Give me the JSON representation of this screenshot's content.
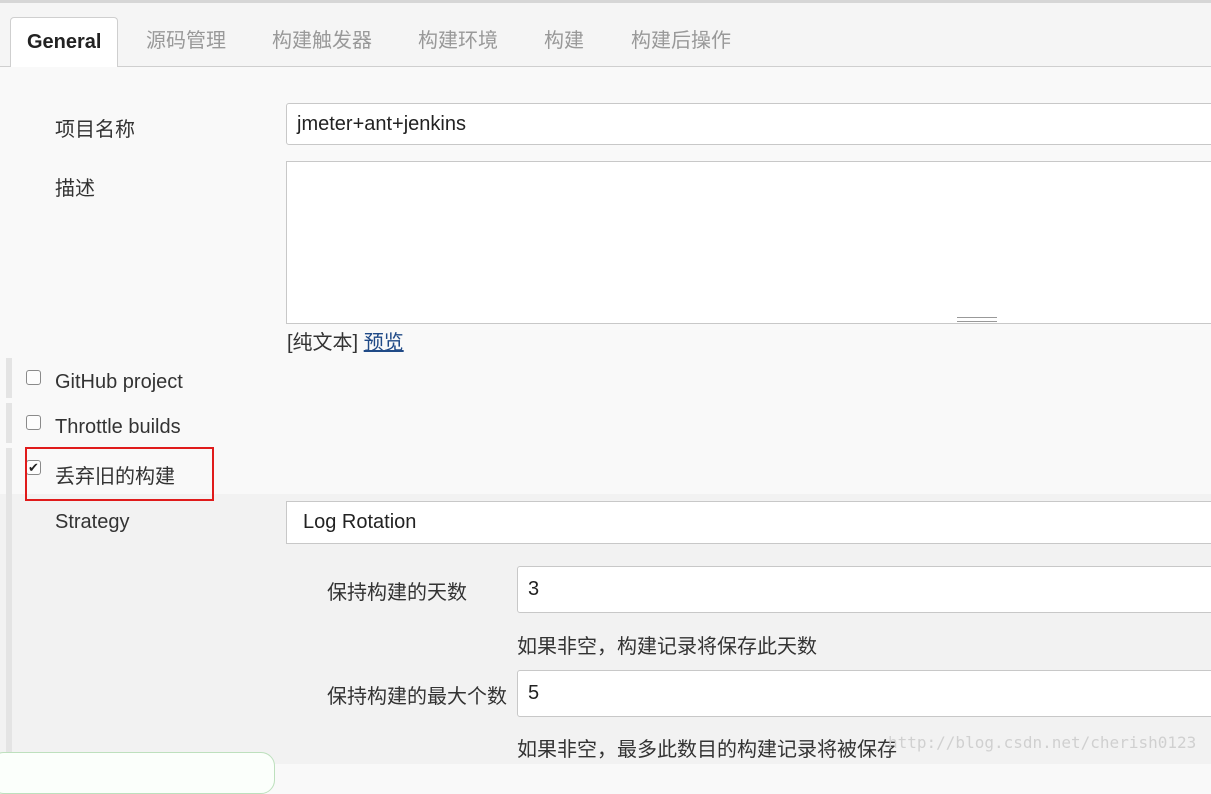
{
  "tabs": [
    {
      "label": "General",
      "active": true
    },
    {
      "label": "源码管理",
      "active": false
    },
    {
      "label": "构建触发器",
      "active": false
    },
    {
      "label": "构建环境",
      "active": false
    },
    {
      "label": "构建",
      "active": false
    },
    {
      "label": "构建后操作",
      "active": false
    }
  ],
  "general": {
    "project_name_label": "项目名称",
    "project_name_value": "jmeter+ant+jenkins",
    "description_label": "描述",
    "description_value": "",
    "format_prefix": "[纯文本]",
    "preview_link": "预览"
  },
  "options": {
    "github_project": {
      "label": "GitHub project",
      "checked": false
    },
    "throttle_builds": {
      "label": "Throttle builds",
      "checked": false
    },
    "discard_old_builds": {
      "label": "丢弃旧的构建",
      "checked": true
    }
  },
  "strategy": {
    "label": "Strategy",
    "selected": "Log Rotation",
    "days_label": "保持构建的天数",
    "days_value": "3",
    "days_hint": "如果非空，构建记录将保存此天数",
    "max_label": "保持构建的最大个数",
    "max_value": "5",
    "max_hint": "如果非空，最多此数目的构建记录将被保存"
  },
  "watermark": "http://blog.csdn.net/cherish0123",
  "colors": {
    "highlight": "#e01b1b",
    "link": "#204a87"
  }
}
